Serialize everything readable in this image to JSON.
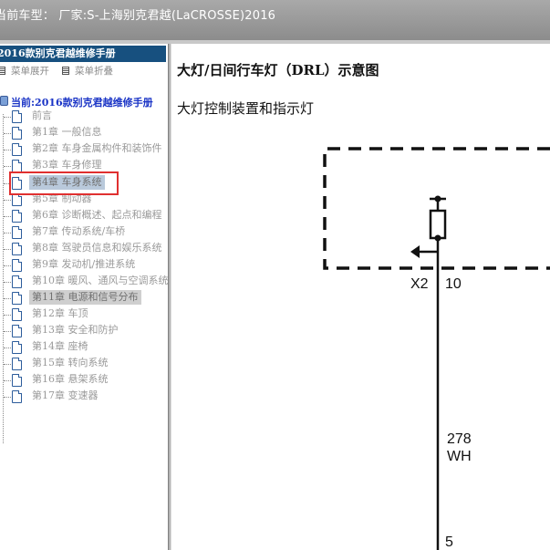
{
  "header": {
    "vehicle_label": "当前车型：  厂家:S-上海别克君越(LaCROSSE)2016"
  },
  "sidebar": {
    "title": "2016款别克君越维修手册",
    "expand_label": "菜单展开",
    "collapse_label": "菜单折叠",
    "current_label": "当前:2016款别克君越维修手册",
    "items": [
      {
        "label": "前言"
      },
      {
        "label": "第1章 一般信息"
      },
      {
        "label": "第2章 车身金属构件和装饰件"
      },
      {
        "label": "第3章 车身修理"
      },
      {
        "label": "第4章 车身系统"
      },
      {
        "label": "第5章 制动器"
      },
      {
        "label": "第6章 诊断概述、起点和编程"
      },
      {
        "label": "第7章 传动系统/车桥"
      },
      {
        "label": "第8章 驾驶员信息和娱乐系统"
      },
      {
        "label": "第9章 发动机/推进系统"
      },
      {
        "label": "第10章 暖风、通风与空调系统"
      },
      {
        "label": "第11章 电源和信号分布"
      },
      {
        "label": "第12章 车顶"
      },
      {
        "label": "第13章 安全和防护"
      },
      {
        "label": "第14章 座椅"
      },
      {
        "label": "第15章 转向系统"
      },
      {
        "label": "第16章 悬架系统"
      },
      {
        "label": "第17章 变速器"
      }
    ]
  },
  "content": {
    "title": "大灯/日间行车灯（DRL）示意图",
    "subtitle": "大灯控制装置和指示灯",
    "diagram": {
      "connector": "X2",
      "pin_top": "10",
      "wire_number": "278",
      "wire_color": "WH",
      "pin_bottom": "5"
    }
  },
  "colors": {
    "header_bg": "#17507f",
    "highlight_red": "#e03030",
    "tree_root_text": "#1a34c6",
    "selected_bg": "#b9c9db"
  }
}
